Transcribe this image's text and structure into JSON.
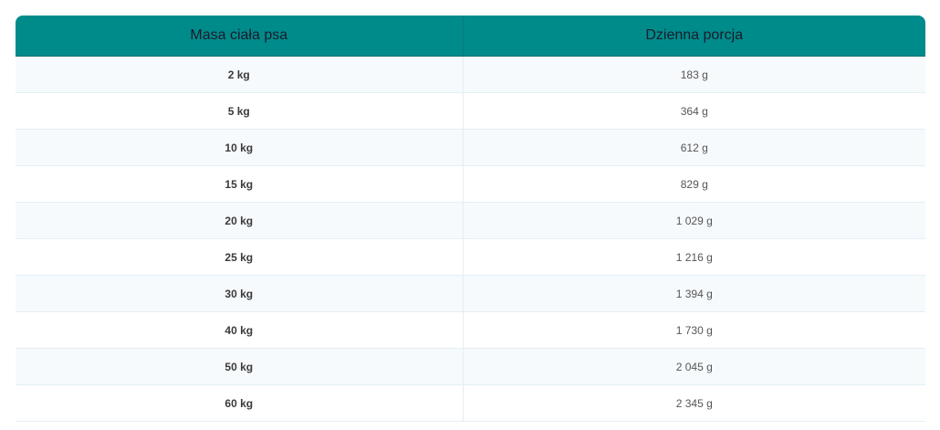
{
  "table": {
    "headers": [
      "Masa ciała psa",
      "Dzienna porcja"
    ],
    "rows": [
      {
        "weight": "2 kg",
        "portion": "183 g"
      },
      {
        "weight": "5 kg",
        "portion": "364 g"
      },
      {
        "weight": "10 kg",
        "portion": "612 g"
      },
      {
        "weight": "15 kg",
        "portion": "829 g"
      },
      {
        "weight": "20 kg",
        "portion": "1 029 g"
      },
      {
        "weight": "25 kg",
        "portion": "1 216 g"
      },
      {
        "weight": "30 kg",
        "portion": "1 394 g"
      },
      {
        "weight": "40 kg",
        "portion": "1 730 g"
      },
      {
        "weight": "50 kg",
        "portion": "2 045 g"
      },
      {
        "weight": "60 kg",
        "portion": "2 345 g"
      }
    ]
  },
  "colors": {
    "header_bg": "#008b8b",
    "row_alt_bg": "#f6fafd",
    "border": "#e4eef4"
  }
}
